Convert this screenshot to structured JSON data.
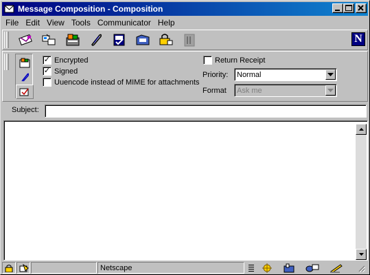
{
  "window": {
    "title": "Message Composition - Composition"
  },
  "menu": {
    "items": [
      {
        "label": "File"
      },
      {
        "label": "Edit"
      },
      {
        "label": "View"
      },
      {
        "label": "Tools"
      },
      {
        "label": "Communicator"
      },
      {
        "label": "Help"
      }
    ]
  },
  "toolbar": {
    "buttons": [
      "send-icon",
      "quote-icon",
      "address-icon",
      "attach-icon",
      "spelling-icon",
      "save-icon",
      "security-icon",
      "stop-icon"
    ],
    "logo": "N"
  },
  "options": {
    "encrypted": {
      "label": "Encrypted",
      "checked": true
    },
    "signed": {
      "label": "Signed",
      "checked": true
    },
    "uuencode": {
      "label": "Uuencode instead of MIME for attachments",
      "checked": false
    },
    "return_receipt": {
      "label": "Return Receipt",
      "checked": false
    },
    "priority": {
      "label": "Priority:",
      "value": "Normal"
    },
    "format": {
      "label": "Format",
      "value": "Ask me"
    }
  },
  "subject": {
    "label": "Subject:",
    "value": ""
  },
  "status": {
    "text": "Netscape"
  },
  "colors": {
    "titlebar": "#000080",
    "face": "#c0c0c0"
  }
}
